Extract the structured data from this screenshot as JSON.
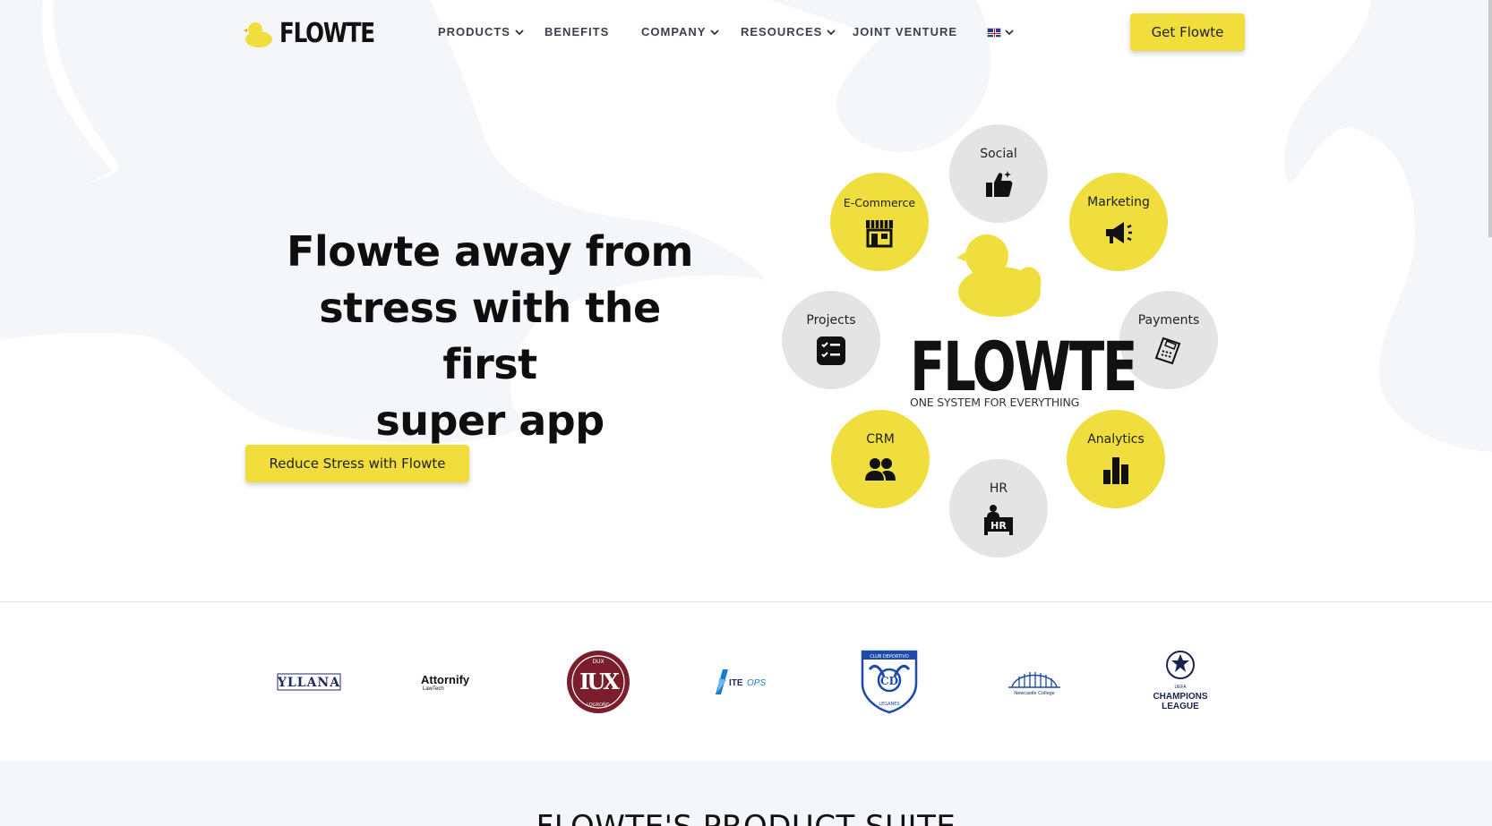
{
  "header": {
    "logo_text": "FLOWTE",
    "nav": [
      {
        "label": "PRODUCTS",
        "has_dropdown": true
      },
      {
        "label": "BENEFITS",
        "has_dropdown": false
      },
      {
        "label": "COMPANY",
        "has_dropdown": true
      },
      {
        "label": "RESOURCES",
        "has_dropdown": true
      },
      {
        "label": "JOINT VENTURE",
        "has_dropdown": false
      }
    ],
    "language_icon": "uk-flag-icon",
    "cta_label": "Get Flowte"
  },
  "hero": {
    "title_lines": [
      "Flowte away from",
      "stress with the first",
      "super app"
    ],
    "cta_label": "Reduce Stress with Flowte"
  },
  "diagram": {
    "center_word": "FLOWTE",
    "center_tagline": "ONE SYSTEM FOR EVERYTHING",
    "modules": [
      {
        "label": "Social",
        "icon": "thumbs-up-icon",
        "color": "gray"
      },
      {
        "label": "E-Commerce",
        "icon": "storefront-icon",
        "color": "yellow"
      },
      {
        "label": "Marketing",
        "icon": "megaphone-icon",
        "color": "yellow"
      },
      {
        "label": "Projects",
        "icon": "checklist-icon",
        "color": "gray"
      },
      {
        "label": "Payments",
        "icon": "card-terminal-icon",
        "color": "gray"
      },
      {
        "label": "CRM",
        "icon": "users-icon",
        "color": "yellow"
      },
      {
        "label": "Analytics",
        "icon": "bar-chart-icon",
        "color": "yellow"
      },
      {
        "label": "HR",
        "icon": "hr-desk-icon",
        "color": "gray"
      }
    ]
  },
  "partners": [
    {
      "name": "YLLANA"
    },
    {
      "name": "Attornify",
      "sub": "LawTech"
    },
    {
      "name": "DUX LOGROÑO",
      "top": "DUX",
      "bottom": "LOGROÑO"
    },
    {
      "name": "ITEOPS"
    },
    {
      "name": "CLUB DEPORTIVO LEGANÉS",
      "top": "CLUB DEPORTIVO",
      "bottom": "LEGANÉS"
    },
    {
      "name": "Newcastle College"
    },
    {
      "name": "UEFA CHAMPIONS LEAGUE",
      "top": "UEFA",
      "line1": "CHAMPIONS",
      "line2": "LEAGUE"
    }
  ],
  "suite": {
    "title": "FLOWTE'S PRODUCT SUITE"
  },
  "colors": {
    "accent": "#f1dd3c",
    "gray_circle": "#e4e4e5",
    "page_bg": "#f5f6f9"
  }
}
